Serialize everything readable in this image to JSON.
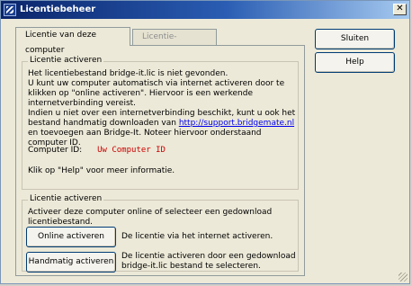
{
  "window": {
    "title": "Licentiebeheer",
    "close_glyph": "✕"
  },
  "tabs": [
    {
      "label": "Licentie van deze computer",
      "active": true
    },
    {
      "label": "Licentie-overzicht",
      "active": false
    }
  ],
  "activate_group": {
    "legend": "Licentie activeren",
    "line1": "Het licentiebestand bridge-it.lic is niet gevonden.",
    "line2": "U kunt uw computer automatisch via internet activeren door te klikken op \"online activeren\". Hiervoor is een werkende internetverbinding vereist.",
    "line3_before": "Indien u niet over een internetverbinding beschikt, kunt u ook het bestand handmatig downloaden van ",
    "link": "http://support.bridgemate.nl",
    "line3_after": " en toevoegen aan Bridge-It. Noteer hiervoor onderstaand computer ID.",
    "computer_id_label": "Computer ID:",
    "computer_id_value": "Uw Computer ID",
    "help_hint": "Klik op \"Help\" voor meer informatie."
  },
  "actions_group": {
    "legend": "Licentie activeren",
    "intro": "Activeer deze computer online of selecteer een gedownload licentiebestand.",
    "online_button": "Online activeren",
    "online_desc": "De licentie via het internet activeren.",
    "manual_button": "Handmatig activeren",
    "manual_desc": "De licentie activeren door een gedownload bridge-it.lic bestand te selecteren."
  },
  "side_buttons": {
    "close": "Sluiten",
    "help": "Help"
  },
  "colors": {
    "titlebar": "#0a246a",
    "link": "#0000ee",
    "computer_id": "#cc0000"
  }
}
